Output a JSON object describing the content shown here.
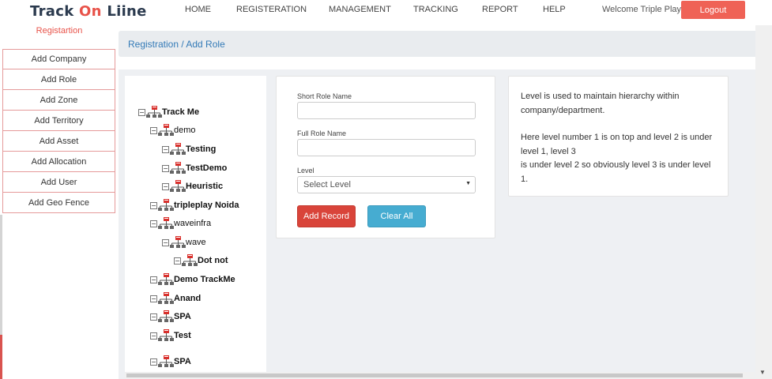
{
  "header": {
    "logo_part1": "Track ",
    "logo_part2": "On",
    "logo_part3": " Liine",
    "nav": [
      {
        "label": "HOME"
      },
      {
        "label": "REGISTERATION"
      },
      {
        "label": "MANAGEMENT"
      },
      {
        "label": "TRACKING"
      },
      {
        "label": "REPORT"
      },
      {
        "label": "HELP"
      }
    ],
    "welcome": "Welcome Triple Play",
    "logout": "Logout"
  },
  "sidebar": {
    "title": "Registartion",
    "items": [
      {
        "label": "Add Company"
      },
      {
        "label": "Add Role"
      },
      {
        "label": "Add Zone"
      },
      {
        "label": "Add Territory"
      },
      {
        "label": "Add Asset"
      },
      {
        "label": "Add Allocation"
      },
      {
        "label": "Add User"
      },
      {
        "label": "Add Geo Fence"
      }
    ]
  },
  "breadcrumb": "Registration / Add Role",
  "tree": [
    {
      "label": "Track Me",
      "bold": true
    },
    {
      "label": "demo",
      "bold": false
    },
    {
      "label": "Testing",
      "bold": true
    },
    {
      "label": "TestDemo",
      "bold": true
    },
    {
      "label": "Heuristic",
      "bold": true
    },
    {
      "label": "tripleplay Noida",
      "bold": true
    },
    {
      "label": "waveinfra",
      "bold": false
    },
    {
      "label": "wave",
      "bold": false
    },
    {
      "label": "Dot not",
      "bold": true
    },
    {
      "label": "Demo TrackMe",
      "bold": true
    },
    {
      "label": "Anand",
      "bold": true
    },
    {
      "label": "SPA",
      "bold": true
    },
    {
      "label": "Test",
      "bold": true
    },
    {
      "label": "SPA",
      "bold": true
    }
  ],
  "form": {
    "short_label": "Short Role Name",
    "short_value": "",
    "full_label": "Full Role Name",
    "full_value": "",
    "level_label": "Level",
    "level_selected": "Select Level",
    "add_label": "Add Record",
    "clear_label": "Clear All"
  },
  "info": {
    "line1": "Level is used to maintain hierarchy within company/department.",
    "line2": "Here level number 1 is on top and level 2 is under level 1, level 3",
    "line3": "is under level 2 so obviously level 3 is under level 1."
  },
  "colors": {
    "accent": "#e8534a",
    "logout": "#ef6256",
    "add_button": "#d9443a",
    "clear_button": "#46acd1",
    "link": "#337ab7"
  },
  "icons": {
    "tree_node": "org-chart-icon",
    "tree_toggle": "collapse-toggle-icon",
    "select": "chevron-down-icon"
  }
}
